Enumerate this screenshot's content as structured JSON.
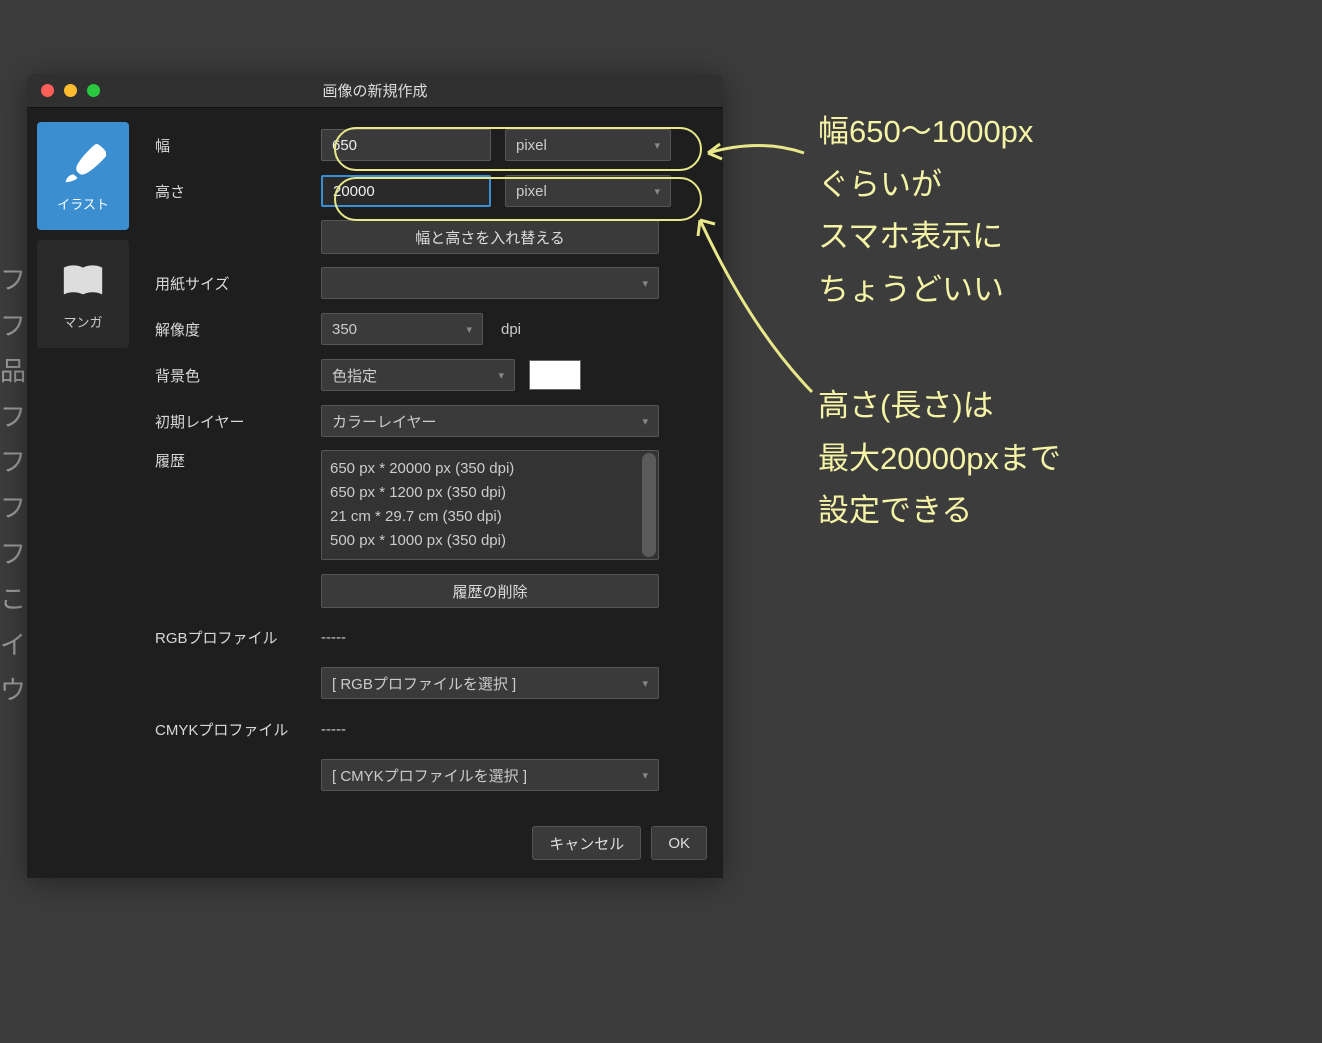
{
  "window": {
    "title": "画像の新規作成"
  },
  "sidebar": {
    "tabs": [
      {
        "label": "イラスト"
      },
      {
        "label": "マンガ"
      }
    ]
  },
  "form": {
    "width_label": "幅",
    "width_value": "650",
    "width_unit": "pixel",
    "height_label": "高さ",
    "height_value": "20000",
    "height_unit": "pixel",
    "swap_button": "幅と高さを入れ替える",
    "paper_label": "用紙サイズ",
    "paper_value": "",
    "resolution_label": "解像度",
    "resolution_value": "350",
    "resolution_unit": "dpi",
    "bg_label": "背景色",
    "bg_value": "色指定",
    "layer_label": "初期レイヤー",
    "layer_value": "カラーレイヤー",
    "history_label": "履歴",
    "history_items": [
      "650 px * 20000 px (350 dpi)",
      "650 px * 1200 px (350 dpi)",
      "21 cm * 29.7 cm (350 dpi)",
      "500 px * 1000 px (350 dpi)"
    ],
    "clear_history_button": "履歴の削除",
    "rgb_label": "RGBプロファイル",
    "rgb_value": "-----",
    "rgb_select": "[ RGBプロファイルを選択 ]",
    "cmyk_label": "CMYKプロファイル",
    "cmyk_value": "-----",
    "cmyk_select": "[ CMYKプロファイルを選択 ]"
  },
  "footer": {
    "cancel": "キャンセル",
    "ok": "OK"
  },
  "annotations": {
    "top": "幅650〜1000px\nぐらいが\nスマホ表示に\nちょうどいい",
    "bottom": "高さ(長さ)は\n最大20000pxまで\n設定できる"
  }
}
